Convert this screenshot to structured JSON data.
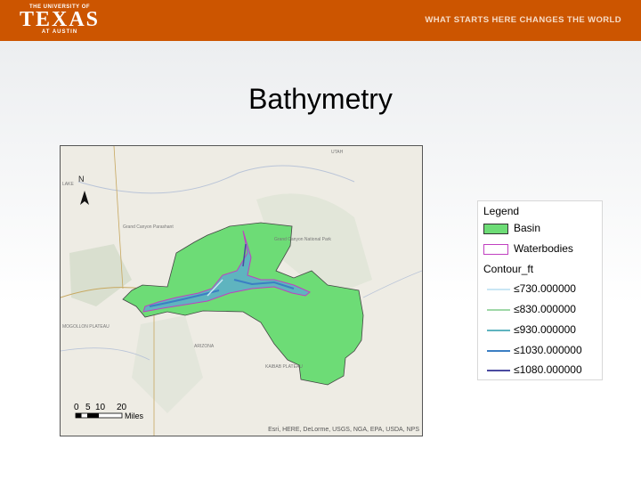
{
  "header": {
    "logo_top": "THE UNIVERSITY OF",
    "logo_main": "TEXAS",
    "logo_sub": "AT AUSTIN",
    "tagline": "WHAT STARTS HERE CHANGES THE WORLD",
    "brand_color": "#cc5500"
  },
  "slide": {
    "title": "Bathymetry"
  },
  "map": {
    "north_label": "N",
    "scale_ticks": [
      "0",
      "5",
      "10",
      "20"
    ],
    "scale_unit": "Miles",
    "credits": "Esri, HERE, DeLorme, USGS, NGA, EPA, USDA, NPS",
    "labels": [
      "UTAH",
      "LAKE",
      "Grand Canyon Parashant",
      "Grand Canyon National Park",
      "MOGOLLON PLATEAU",
      "ARIZONA",
      "KAIBAB PLATEAU"
    ],
    "colors": {
      "basin": "#6ddc76",
      "waterbodies": "#c040c0"
    }
  },
  "legend": {
    "title": "Legend",
    "basin_label": "Basin",
    "waterbodies_label": "Waterbodies",
    "contour_title": "Contour_ft",
    "contours": [
      {
        "label": "≤730.000000",
        "color": "#c9e6f4"
      },
      {
        "label": "≤830.000000",
        "color": "#9fd8a8"
      },
      {
        "label": "≤930.000000",
        "color": "#5fb4bf"
      },
      {
        "label": "≤1030.000000",
        "color": "#3b7fc4"
      },
      {
        "label": "≤1080.000000",
        "color": "#4a4aa0"
      }
    ]
  }
}
